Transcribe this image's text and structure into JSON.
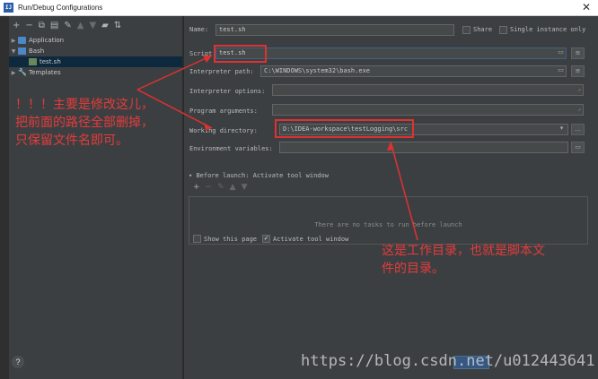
{
  "window": {
    "title": "Run/Debug Configurations",
    "app_icon": "IJ"
  },
  "left_toolbar": [
    "+",
    "−",
    "⧉",
    "▤",
    "✎",
    "▲",
    "▼",
    "▰",
    "⇅"
  ],
  "tree": {
    "application": "Application",
    "bash": "Bash",
    "bash_child": "test.sh",
    "templates": "Templates"
  },
  "form": {
    "name_label": "Name:",
    "name_value": "test.sh",
    "share_label": "Share",
    "single_instance_label": "Single instance only",
    "script_label": "Script:",
    "script_value": "test.sh",
    "interpreter_path_label": "Interpreter path:",
    "interpreter_path_value": "C:\\WINDOWS\\system32\\bash.exe",
    "interpreter_options_label": "Interpreter options:",
    "program_arguments_label": "Program arguments:",
    "working_directory_label": "Working directory:",
    "working_directory_value": "D:\\IDEA-workspace\\testLogging\\src",
    "env_vars_label": "Environment variables:",
    "before_launch_label": "Before launch: Activate tool window",
    "before_launch_empty": "There are no tasks to run before launch",
    "show_page_label": "Show this page",
    "activate_tool_window_label": "Activate tool window"
  },
  "annotations": {
    "note1_line1": "！！！主要是修改这儿，",
    "note1_line2": "把前面的路径全部删掉，",
    "note1_line3": "只保留文件名即可。",
    "note2_line1": "这是工作目录，也就是脚本文",
    "note2_line2": "件的目录。"
  },
  "watermark": "https://blog.csdn.net/u012443641",
  "help_label": "?",
  "colors": {
    "accent": "#e03131",
    "selection": "#0d293e",
    "panel": "#3c3f41"
  }
}
